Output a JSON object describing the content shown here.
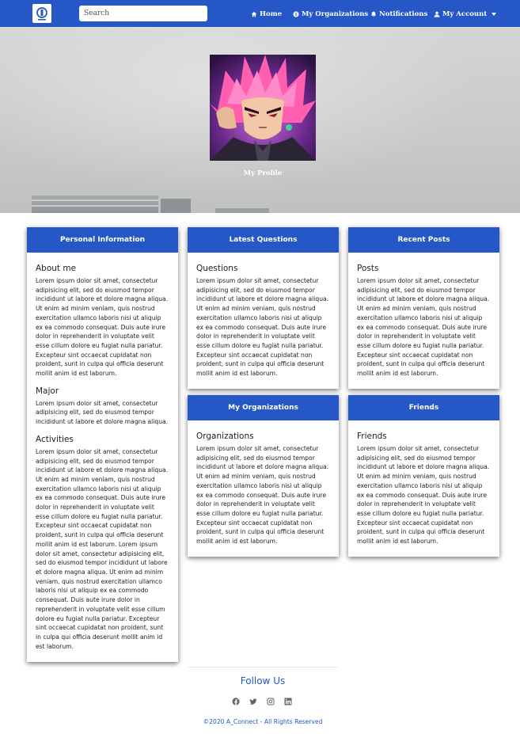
{
  "nav": {
    "search_placeholder": "Search",
    "items": [
      {
        "label": "Home",
        "icon": "home-icon"
      },
      {
        "label": "My Organizations",
        "icon": "globe-icon"
      },
      {
        "label": "Notifications",
        "icon": "bell-icon"
      },
      {
        "label": "My Account",
        "icon": "user-icon"
      }
    ]
  },
  "hero": {
    "caption": "My Profile"
  },
  "lorem": {
    "short": "Lorem ipsum dolor sit amet, consectetur adipisicing elit, sed do eiusmod tempor incididunt ut labore et dolore magna aliqua.",
    "full": "Lorem ipsum dolor sit amet, consectetur adipisicing elit, sed do eiusmod tempor incididunt ut labore et dolore magna aliqua. Ut enim ad minim veniam, quis nostrud exercitation ullamco laboris nisi ut aliquip ex ea commodo consequat. Duis aute irure dolor in reprehenderit in voluptate velit esse cillum dolore eu fugiat nulla pariatur. Excepteur sint occaecat cupidatat non proident, sunt in culpa qui officia deserunt mollit anim id est laborum.",
    "double": "Lorem ipsum dolor sit amet, consectetur adipisicing elit, sed do eiusmod tempor incididunt ut labore et dolore magna aliqua. Ut enim ad minim veniam, quis nostrud exercitation ullamco laboris nisi ut aliquip ex ea commodo consequat. Duis aute irure dolor in reprehenderit in voluptate velit esse cillum dolore eu fugiat nulla pariatur. Excepteur sint occaecat cupidatat non proident, sunt in culpa qui officia deserunt mollit anim id est laborum. Lorem ipsum dolor sit amet, consectetur adipisicing elit, sed do eiusmod tempor incididunt ut labore et dolore magna aliqua. Ut enim ad minim veniam, quis nostrud exercitation ullamco laboris nisi ut aliquip ex ea commodo consequat. Duis aute irure dolor in reprehenderit in voluptate velit esse cillum dolore eu fugiat nulla pariatur. Excepteur sint occaecat cupidatat non proident, sunt in culpa qui officia deserunt mollit anim id est laborum."
  },
  "cards": {
    "personal": {
      "title": "Personal Information",
      "about_title": "About me",
      "major_title": "Major",
      "activities_title": "Activities"
    },
    "questions": {
      "title": "Latest Questions",
      "section_title": "Questions"
    },
    "posts": {
      "title": "Recent Posts",
      "section_title": "Posts"
    },
    "organizations": {
      "title": "My Organizations",
      "section_title": "Organizations"
    },
    "friends": {
      "title": "Friends",
      "section_title": "Friends"
    }
  },
  "footer": {
    "follow": "Follow Us",
    "socials": [
      "facebook-icon",
      "twitter-icon",
      "instagram-icon",
      "linkedin-icon"
    ],
    "copyright": "©2020 A_Connect - All Rights Reserved"
  },
  "colors": {
    "primary": "#2558c6",
    "text": "#222222"
  }
}
